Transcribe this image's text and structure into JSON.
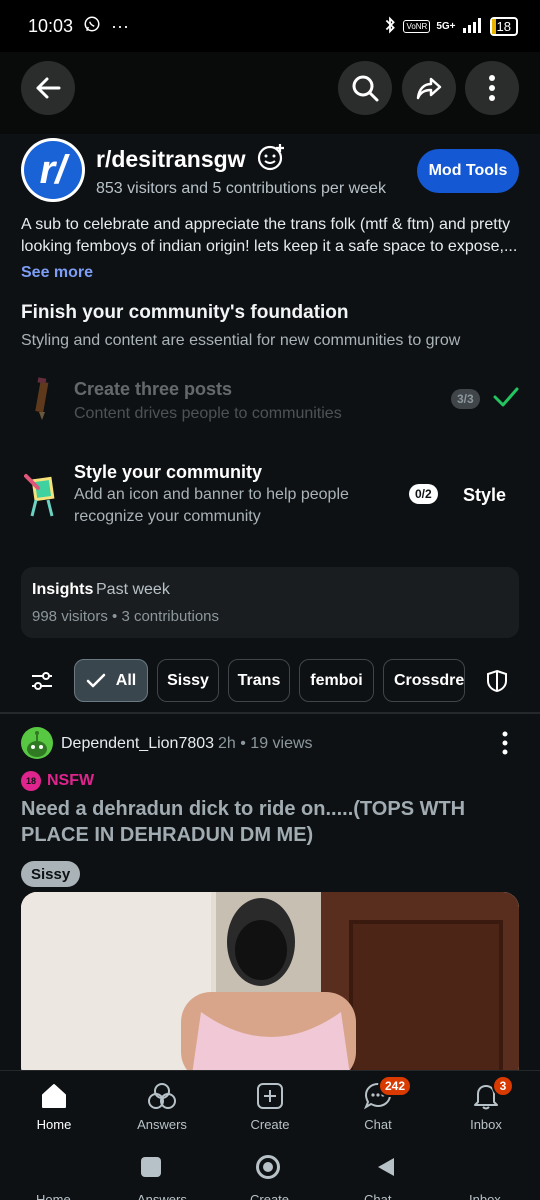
{
  "status": {
    "time": "10:03",
    "network": "5G+",
    "volte": "VoNR",
    "battery": "18"
  },
  "community": {
    "name": "r/desitransgw",
    "stats": "853 visitors and 5 contributions per week",
    "mod_tools_label": "Mod Tools",
    "description": "A sub to celebrate and appreciate the trans folk (mtf & ftm) and pretty looking femboys of indian origin! lets keep it a safe space to expose,...",
    "see_more": "See more"
  },
  "foundation": {
    "title": "Finish your community's foundation",
    "subtitle": "Styling and content are essential for new communities to grow",
    "tasks": [
      {
        "title": "Create three posts",
        "desc": "Content drives people to communities",
        "count": "3/3",
        "done": true
      },
      {
        "title": "Style your community",
        "desc": "Add an icon and banner to help people recognize your community",
        "count": "0/2",
        "action": "Style",
        "done": false
      }
    ]
  },
  "insights": {
    "title": "Insights",
    "period": "Past week",
    "stats": "998 visitors • 3 contributions"
  },
  "filters": [
    "All",
    "Sissy",
    "Trans",
    "femboi",
    "Crossdres"
  ],
  "post": {
    "user": "Dependent_Lion7803",
    "meta": "2h • 19 views",
    "nsfw_label": "NSFW",
    "nsfw_icon": "18",
    "title": "Need a dehradun dick to ride on.....(TOPS WTH PLACE IN DEHRADUN DM ME)",
    "flair": "Sissy"
  },
  "nav": [
    {
      "label": "Home",
      "icon": "home-icon"
    },
    {
      "label": "Answers",
      "icon": "answers-icon"
    },
    {
      "label": "Create",
      "icon": "create-icon"
    },
    {
      "label": "Chat",
      "icon": "chat-icon",
      "badge": "242"
    },
    {
      "label": "Inbox",
      "icon": "inbox-icon",
      "badge": "3"
    }
  ],
  "colors": {
    "accent": "#1458d4",
    "nsfw": "#e0248e",
    "badge": "#d93a00",
    "success": "#22c55e"
  }
}
